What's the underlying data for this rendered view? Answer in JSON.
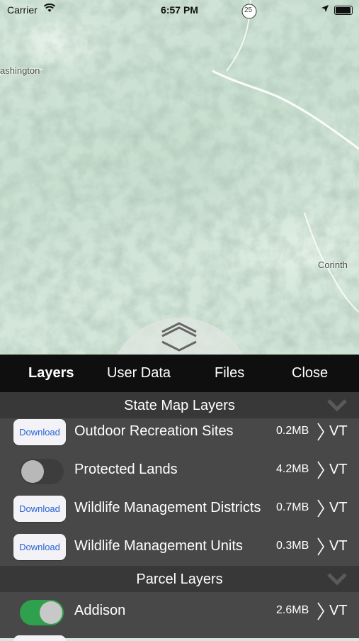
{
  "status_bar": {
    "carrier": "Carrier",
    "time": "6:57 PM"
  },
  "map": {
    "labels": {
      "washington": "ashington",
      "corinth": "Corinth",
      "route_shield": "25"
    }
  },
  "tabs": [
    "Layers",
    "User Data",
    "Files",
    "Close"
  ],
  "active_tab": "Layers",
  "sections": [
    {
      "title": "State Map Layers",
      "rows": [
        {
          "control": "download",
          "button_label": "Download",
          "name": "Outdoor Recreation Sites",
          "size": "0.2MB",
          "type": "VT"
        },
        {
          "control": "toggle",
          "toggle_state": "off",
          "name": "Protected Lands",
          "size": "4.2MB",
          "type": "VT"
        },
        {
          "control": "download",
          "button_label": "Download",
          "name": "Wildlife Management Districts",
          "size": "0.7MB",
          "type": "VT"
        },
        {
          "control": "download",
          "button_label": "Download",
          "name": "Wildlife Management Units",
          "size": "0.3MB",
          "type": "VT"
        }
      ]
    },
    {
      "title": "Parcel Layers",
      "rows": [
        {
          "control": "toggle",
          "toggle_state": "on",
          "name": "Addison",
          "size": "2.6MB",
          "type": "VT"
        }
      ]
    }
  ],
  "colors": {
    "toggle_on": "#2fa04d",
    "download_text": "#2a62d4",
    "tab_bar": "#0f0f0f",
    "panel": "#484848",
    "section_header": "#383838"
  }
}
